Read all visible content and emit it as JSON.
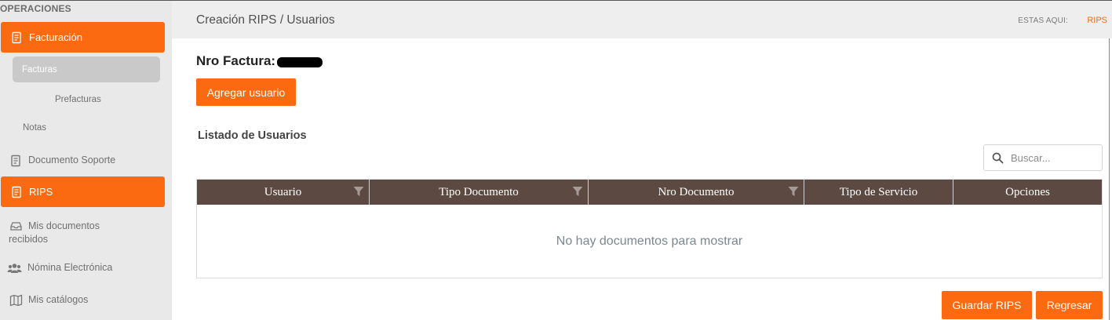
{
  "sidebar": {
    "section_title": "OPERACIONES",
    "items": {
      "facturacion": {
        "label": "Facturación",
        "icon": "document-icon"
      },
      "facturas": {
        "label": "Facturas"
      },
      "prefacturas": {
        "label": "Prefacturas"
      },
      "notas": {
        "label": "Notas"
      },
      "documento_soporte": {
        "label": "Documento Soporte",
        "icon": "document-icon"
      },
      "rips": {
        "label": "RIPS",
        "icon": "document-icon"
      },
      "mis_documentos_l1": "Mis documentos",
      "mis_documentos_l2": "recibidos",
      "nomina": {
        "label": "Nómina Electrónica",
        "icon": "users-icon"
      },
      "catalogos": {
        "label": "Mis catálogos",
        "icon": "map-icon"
      }
    }
  },
  "header": {
    "title": "Creación RIPS / Usuarios",
    "breadcrumb_label": "ESTAS AQUI:",
    "breadcrumb_link": "RIPS"
  },
  "invoice": {
    "label": "Nro Factura:"
  },
  "buttons": {
    "add_user": "Agregar usuario",
    "save": "Guardar RIPS",
    "back": "Regresar"
  },
  "list": {
    "title": "Listado de Usuarios",
    "search_placeholder": "Buscar...",
    "columns": [
      "Usuario",
      "Tipo Documento",
      "Nro Documento",
      "Tipo de Servicio",
      "Opciones"
    ],
    "empty_message": "No hay documentos para mostrar"
  },
  "colors": {
    "accent": "#fb6a10",
    "table_header": "#5c4a42",
    "sidebar_bg": "#e9e9e9"
  }
}
